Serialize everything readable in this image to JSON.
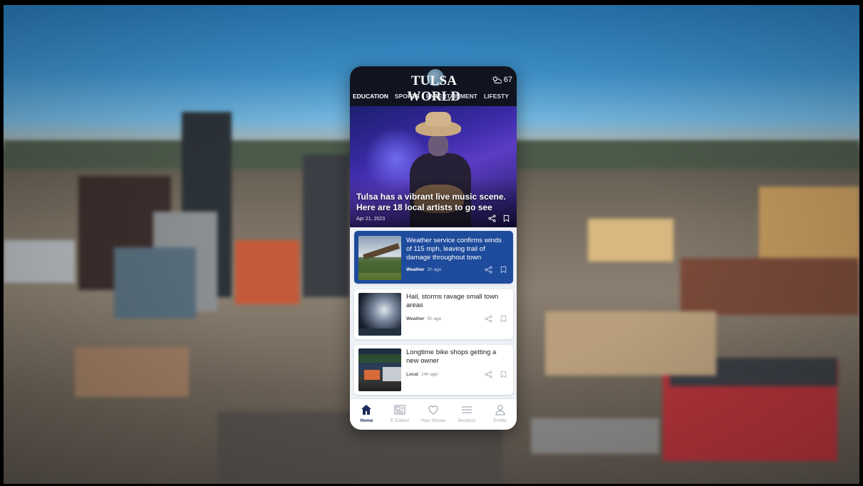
{
  "app": {
    "logo": "TULSA WORLD",
    "temperature": "67",
    "weather_icon": "partly-sunny-icon"
  },
  "tabs": [
    {
      "label": "EDUCATION",
      "active": true
    },
    {
      "label": "SPORTS",
      "active": false
    },
    {
      "label": "ENTERTAINMENT",
      "active": false
    },
    {
      "label": "LIFESTY",
      "active": false
    }
  ],
  "hero": {
    "title": "Tulsa has a vibrant live music scene. Here are 18 local artists to go see",
    "date": "Apr 21, 2023"
  },
  "articles": [
    {
      "title": "Weather service confirms winds of 115 mph, leaving trail of damage throughout town",
      "category": "Weather",
      "time": "2h ago",
      "featured": true
    },
    {
      "title": "Hail, storms ravage small town areas",
      "category": "Weather",
      "time": "5h ago",
      "featured": false
    },
    {
      "title": "Longtime bike shops getting a new owner",
      "category": "Local",
      "time": "14h ago",
      "featured": false
    }
  ],
  "bottom_nav": [
    {
      "label": "Home",
      "icon": "home-icon",
      "active": true
    },
    {
      "label": "E-Edition",
      "icon": "newspaper-icon",
      "active": false
    },
    {
      "label": "Your Stories",
      "icon": "heart-icon",
      "active": false
    },
    {
      "label": "Sections",
      "icon": "list-icon",
      "active": false
    },
    {
      "label": "Profile",
      "icon": "person-icon",
      "active": false
    }
  ],
  "colors": {
    "header_bg": "#0f1420",
    "featured_card": "#1e4b9c",
    "nav_active": "#1b2c5a"
  }
}
